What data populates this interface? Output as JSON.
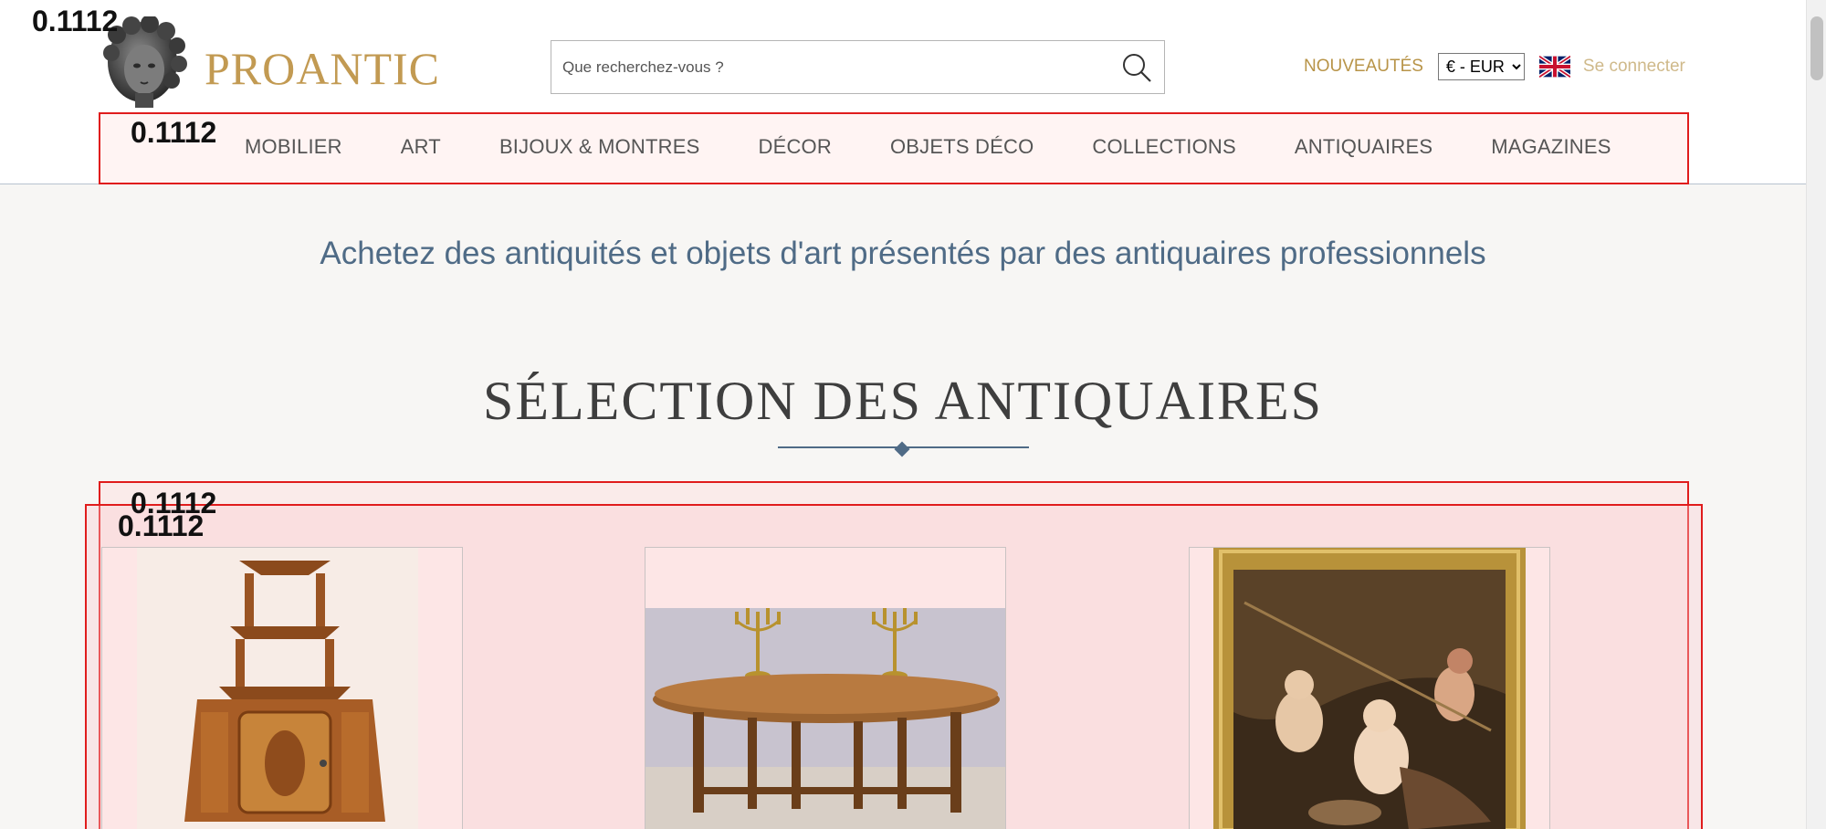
{
  "header": {
    "logo_text": "PROANTIC",
    "search_placeholder": "Que recherchez-vous ?",
    "new_label": "NOUVEAUTÉS",
    "currency_selected": "€ - EUR",
    "login_label": "Se connecter"
  },
  "nav": {
    "items": [
      "MOBILIER",
      "ART",
      "BIJOUX & MONTRES",
      "DÉCOR",
      "OBJETS DÉCO",
      "COLLECTIONS",
      "ANTIQUAIRES",
      "MAGAZINES"
    ]
  },
  "overlay_scores": [
    "0.1112",
    "0.1112",
    "0.1112",
    "0.1112"
  ],
  "main": {
    "tagline": "Achetez des antiquités et objets d'art présentés par des antiquaires professionnels",
    "section_title": "SÉLECTION DES ANTIQUAIRES"
  },
  "icons": {
    "search": "search-icon",
    "flag": "uk-flag-icon",
    "logo": "sculpted-head-logo-icon",
    "dropdown": "chevron-down-icon"
  },
  "colors": {
    "brand_gold": "#c29a52",
    "accent_blue": "#4f6b86",
    "highlight_red": "#e01c1c"
  }
}
